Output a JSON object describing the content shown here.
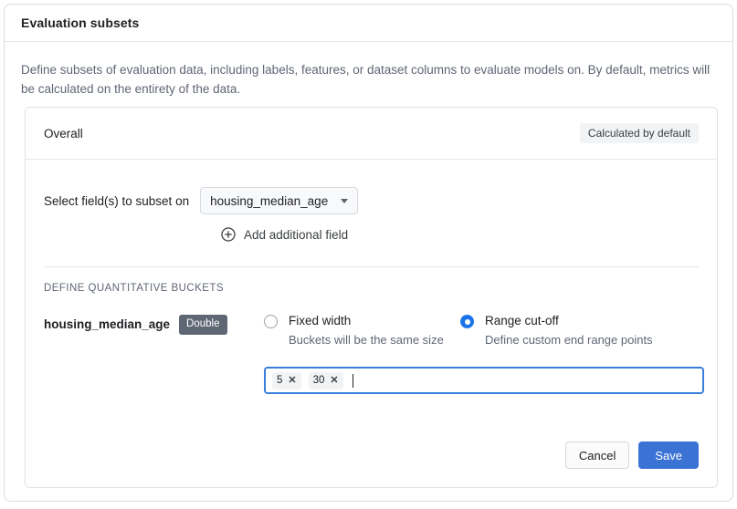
{
  "card": {
    "title": "Evaluation subsets",
    "description": "Define subsets of evaluation data, including labels, features, or dataset columns to evaluate models on. By default, metrics will be calculated on the entirety of the data."
  },
  "subset": {
    "name": "Overall",
    "badge": "Calculated by default",
    "field_select": {
      "label": "Select field(s) to subset on",
      "selected": "housing_median_age",
      "caret_icon": "chevron-down-icon"
    },
    "add_field": {
      "label": "Add additional field",
      "icon": "circle-plus-icon"
    },
    "section_title": "DEFINE QUANTITATIVE BUCKETS",
    "bucket": {
      "field_name": "housing_median_age",
      "type_badge": "Double",
      "options": [
        {
          "title": "Fixed width",
          "subtitle": "Buckets will be the same size",
          "selected": false
        },
        {
          "title": "Range cut-off",
          "subtitle": "Define custom end range points",
          "selected": true
        }
      ],
      "cutoffs": [
        "5",
        "30"
      ],
      "chip_remove_icon": "close-icon"
    }
  },
  "footer": {
    "cancel_label": "Cancel",
    "save_label": "Save"
  },
  "colors": {
    "accent_blue": "#1a73e8",
    "save_blue": "#3b73d4",
    "focus_blue": "#3b7ddd",
    "type_badge_bg": "#5f6775",
    "muted_text": "#5f6674"
  }
}
